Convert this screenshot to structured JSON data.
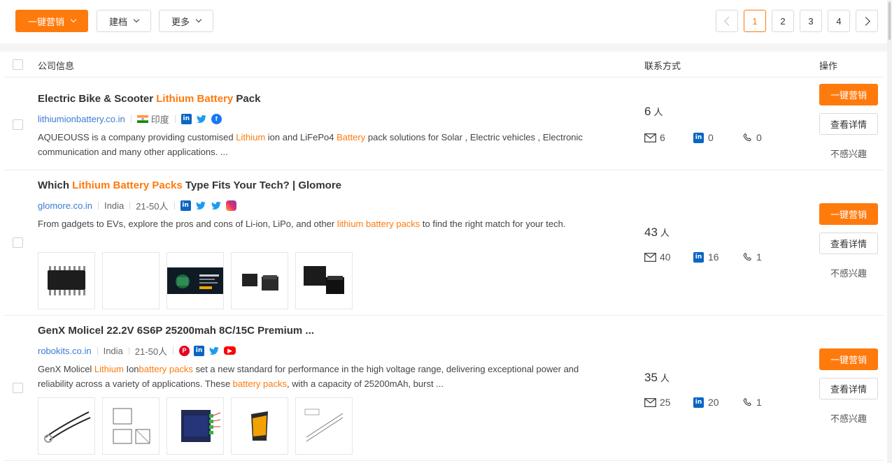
{
  "toolbar": {
    "marketing_label": "一键营销",
    "archive_label": "建档",
    "more_label": "更多"
  },
  "pagination": {
    "pages": [
      "1",
      "2",
      "3",
      "4"
    ],
    "current": "1"
  },
  "table_header": {
    "company_info": "公司信息",
    "contact": "联系方式",
    "actions": "操作"
  },
  "rows": [
    {
      "title_parts": [
        "Electric Bike & Scooter ",
        "Lithium Battery",
        " Pack"
      ],
      "domain": "lithiumionbattery.co.in",
      "country": "印度",
      "desc_parts": [
        "AQUEOUSS is a company providing customised ",
        "Lithium",
        " ion and LiFePo4 ",
        "Battery",
        " pack solutions for Solar , Electric vehicles , Electronic communication and many other applications. ..."
      ],
      "people_count": "6",
      "people_unit": "人",
      "email_count": "6",
      "linkedin_count": "0",
      "phone_count": "0",
      "marketing_label": "一键营销",
      "detail_label": "查看详情",
      "not_interested_label": "不感兴趣"
    },
    {
      "title_parts": [
        "Which ",
        "Lithium Battery Packs",
        " Type Fits Your Tech? | Glomore"
      ],
      "domain": "glomore.co.in",
      "country": "India",
      "size": "21-50人",
      "desc_parts": [
        "From gadgets to EVs, explore the pros and cons of Li-ion, LiPo, and other ",
        "lithium battery packs",
        " to find the right match for your tech."
      ],
      "people_count": "43",
      "people_unit": "人",
      "email_count": "40",
      "linkedin_count": "16",
      "phone_count": "1",
      "marketing_label": "一键营销",
      "detail_label": "查看详情",
      "not_interested_label": "不感兴趣"
    },
    {
      "title_parts": [
        "GenX Molicel 22.2V 6S6P 25200mah 8C/15C Premium ..."
      ],
      "domain": "robokits.co.in",
      "country": "India",
      "size": "21-50人",
      "desc_parts": [
        "GenX Molicel ",
        "Lithium",
        " Ion",
        "battery packs",
        " set a new standard for performance in the high voltage range, delivering exceptional power and reliability across a variety of applications. These ",
        "battery packs",
        ", with a capacity of 25200mAh, burst ..."
      ],
      "people_count": "35",
      "people_unit": "人",
      "email_count": "25",
      "linkedin_count": "20",
      "phone_count": "1",
      "marketing_label": "一键营销",
      "detail_label": "查看详情",
      "not_interested_label": "不感兴趣"
    }
  ],
  "icons": {
    "linkedin": "in",
    "facebook": "f",
    "pinterest": "P",
    "youtube": "▶"
  },
  "colors": {
    "accent": "#ff7a0d",
    "link": "#3a7bd5",
    "linkedin": "#0a66c2"
  }
}
